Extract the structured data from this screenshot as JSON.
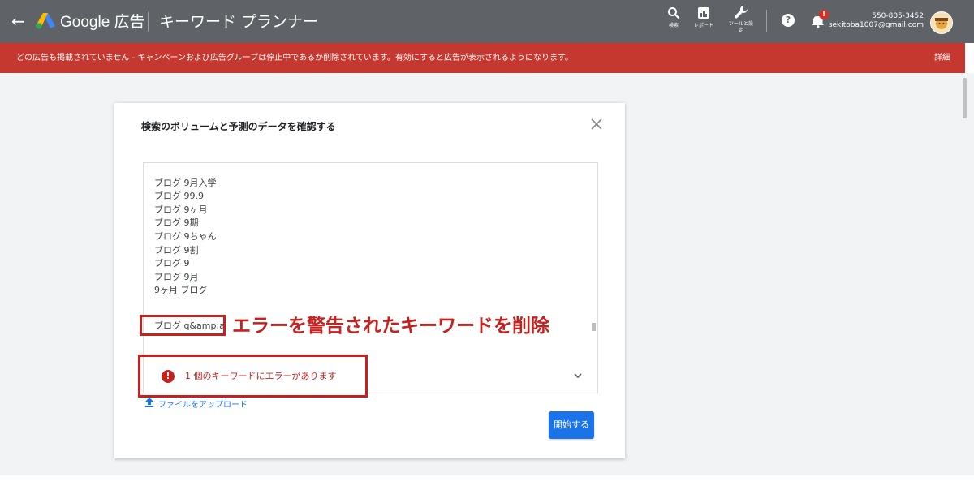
{
  "topbar": {
    "brand": "Google 広告",
    "title": "キーワード プランナー",
    "icons": [
      {
        "name": "search-icon",
        "caption": "検索"
      },
      {
        "name": "reports-icon",
        "caption": "レポート"
      },
      {
        "name": "tools-icon",
        "caption": "ツールと設定"
      }
    ],
    "help_glyph": "?",
    "notification_badge": "!",
    "account": {
      "phone": "550-805-3452",
      "email": "sekitoba1007@gmail.com"
    }
  },
  "alert": {
    "message": "どの広告も掲載されていません - キャンペーンおよび広告グループは停止中であるか削除されています。有効にすると広告が表示されるようになります。",
    "link": "詳細"
  },
  "dialog": {
    "title": "検索のボリュームと予測のデータを確認する",
    "keywords": [
      "ブログ 9月入学",
      "ブログ 99.9",
      "ブログ 9ヶ月",
      "ブログ 9期",
      "ブログ 9ちゃん",
      "ブログ 9割",
      "ブログ 9",
      "ブログ 9月",
      "9ヶ月 ブログ"
    ],
    "error_keyword": "ブログ q&amp;a",
    "error_message": "1 個のキーワードにエラーがあります",
    "upload_label": "ファイルをアップロード",
    "start_button": "開始する"
  },
  "annotation": {
    "text": "エラーを警告されたキーワードを削除"
  },
  "colors": {
    "topbar": "#5f6368",
    "alert": "#c5382f",
    "error": "#c5221f",
    "primary": "#1a73e8",
    "canvas": "#f1f3f4"
  }
}
